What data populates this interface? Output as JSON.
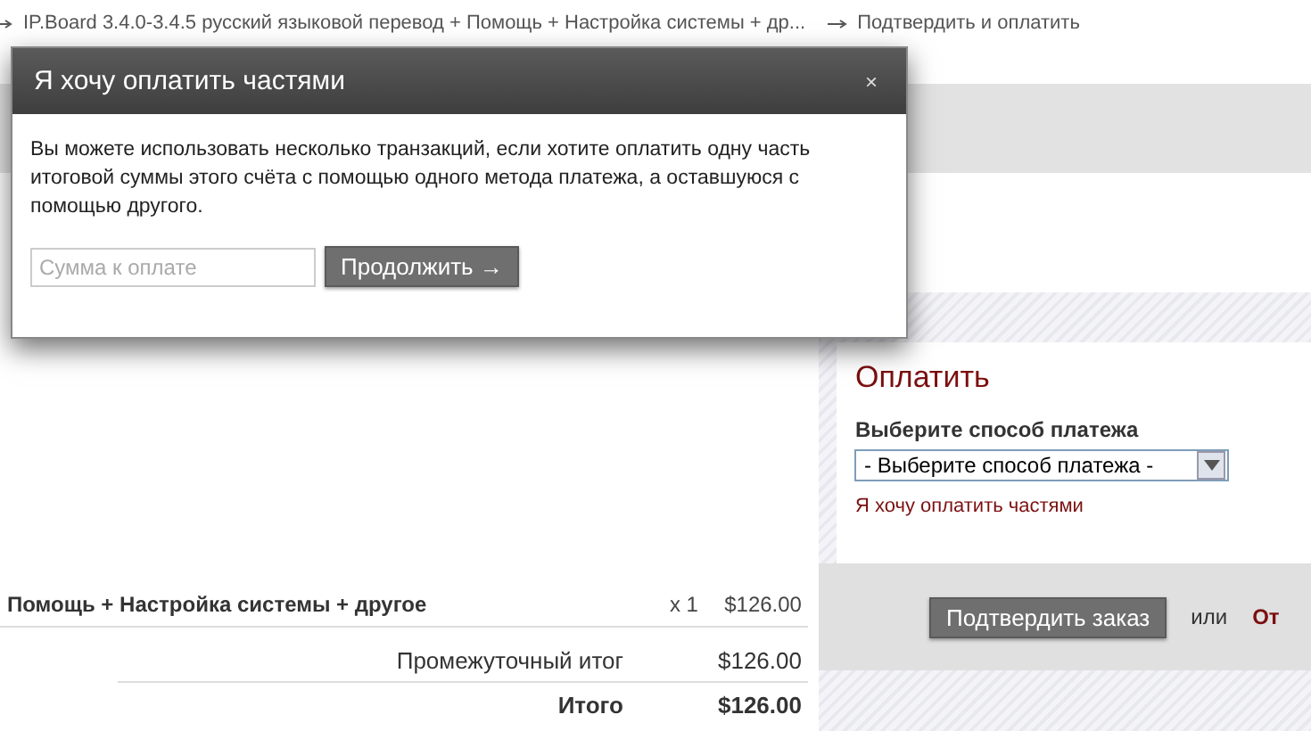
{
  "breadcrumb": [
    {
      "text": "IP.Board 3.4.0-3.4.5 русский языковой перевод + Помощь + Настройка системы + др..."
    },
    {
      "text": "Подтвердить и оплатить"
    }
  ],
  "modal": {
    "title": "Я хочу оплатить частями",
    "close": "×",
    "text": "Вы можете использовать несколько транзакций, если хотите оплатить одну часть итоговой суммы этого счёта с помощью одного метода платежа, а оставшуюся с помощью другого.",
    "amount_placeholder": "Сумма к оплате",
    "continue_button": "Продолжить →"
  },
  "order": {
    "items": [
      {
        "name": "Помощь + Настройка системы + другое",
        "qty": "x 1",
        "price": "$126.00"
      }
    ],
    "subtotal_label": "Промежуточный итог",
    "subtotal": "$126.00",
    "total_label": "Итого",
    "total": "$126.00"
  },
  "payment": {
    "title": "Оплатить",
    "method_label": "Выберите способ платежа",
    "method_select": "- Выберите способ платежа -",
    "split_link": "Я хочу оплатить частями",
    "confirm_button": "Подтвердить заказ",
    "or": "или",
    "cancel_link": "От"
  }
}
